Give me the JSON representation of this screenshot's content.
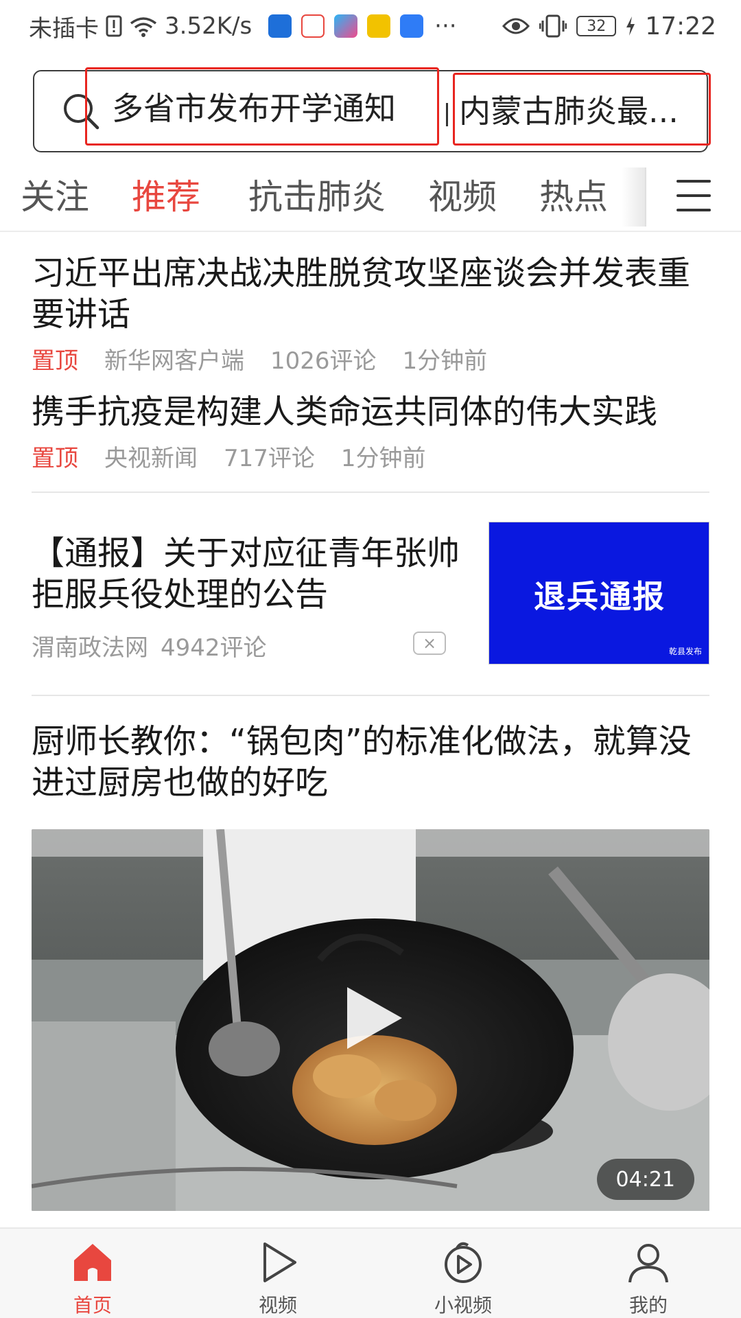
{
  "statusbar": {
    "carrier": "未插卡",
    "speed": "3.52K/s",
    "apps": [
      {
        "icon": "shield-app-icon",
        "color": "#1e6fd9"
      },
      {
        "icon": "baidu-app-icon",
        "color": "#e8473f"
      },
      {
        "icon": "youku-app-icon",
        "color": "#2bb5f5"
      },
      {
        "icon": "helmet-app-icon",
        "color": "#f2c200"
      },
      {
        "icon": "36kr-app-icon",
        "color": "#2f7cf6"
      }
    ],
    "more": "···",
    "battery": "32",
    "time": "17:22"
  },
  "search": {
    "hot1": "多省市发布开学通知",
    "hot2": "内蒙古肺炎最..."
  },
  "tabs": [
    "关注",
    "推荐",
    "抗击肺炎",
    "视频",
    "热点"
  ],
  "active_tab": "推荐",
  "feed": {
    "items": [
      {
        "title": "习近平出席决战决胜脱贫攻坚座谈会并发表重要讲话",
        "pin": "置顶",
        "source": "新华网客户端",
        "comments": "1026评论",
        "time": "1分钟前"
      },
      {
        "title": "携手抗疫是构建人类命运共同体的伟大实践",
        "pin": "置顶",
        "source": "央视新闻",
        "comments": "717评论",
        "time": "1分钟前"
      }
    ],
    "ad": {
      "title": "【通报】关于对应征青年张帅拒服兵役处理的公告",
      "source": "渭南政法网",
      "comments": "4942评论",
      "close": "×",
      "thumb_text": "退兵通报",
      "thumb_small": "乾县发布",
      "thumb_color": "#0a18e0"
    },
    "video": {
      "title": "厨师长教你：“锅包肉”的标准化做法，就算没进过厨房也做的好吃",
      "duration": "04:21"
    }
  },
  "bottomnav": [
    {
      "label": "首页",
      "icon": "home-icon"
    },
    {
      "label": "视频",
      "icon": "play-icon"
    },
    {
      "label": "小视频",
      "icon": "short-video-icon"
    },
    {
      "label": "我的",
      "icon": "profile-icon"
    }
  ],
  "colors": {
    "accent": "#e8473f",
    "highlight_box": "#e8251f"
  }
}
